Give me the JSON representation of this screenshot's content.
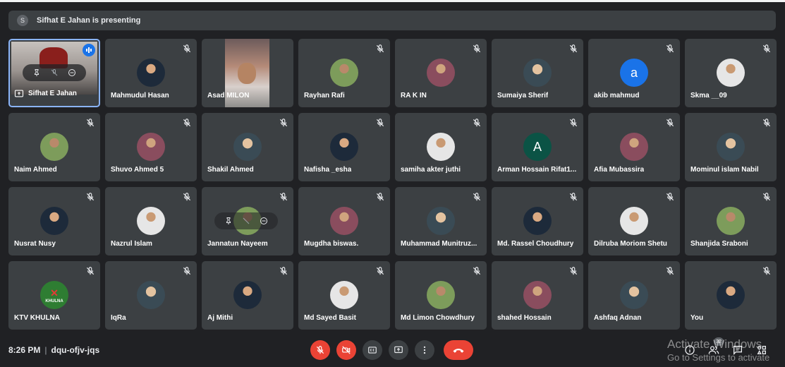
{
  "presenting_bar": {
    "avatar_letter": "S",
    "text": "Sifhat E Jahan is presenting"
  },
  "participants": [
    {
      "name": "Sifhat E Jahan",
      "kind": "presenter",
      "muted": false
    },
    {
      "name": "Mahmudul Hasan",
      "kind": "photo",
      "muted": true
    },
    {
      "name": "Asad MILON",
      "kind": "video",
      "muted": false
    },
    {
      "name": "Rayhan Rafi",
      "kind": "photo",
      "muted": true
    },
    {
      "name": "RA K IN",
      "kind": "photo",
      "muted": true
    },
    {
      "name": "Sumaiya Sherif",
      "kind": "photo",
      "muted": true
    },
    {
      "name": "akib mahmud",
      "kind": "letter",
      "letter": "a",
      "color": "#1a73e8",
      "muted": true
    },
    {
      "name": "Skma __09",
      "kind": "photo",
      "muted": true
    },
    {
      "name": "Naim Ahmed",
      "kind": "photo",
      "muted": true
    },
    {
      "name": "Shuvo Ahmed 5",
      "kind": "photo",
      "muted": true
    },
    {
      "name": "Shakil Ahmed",
      "kind": "photo",
      "muted": true
    },
    {
      "name": "Nafisha _esha",
      "kind": "photo",
      "muted": true
    },
    {
      "name": "samiha akter juthi",
      "kind": "photo",
      "muted": true
    },
    {
      "name": "Arman Hossain Rifat1...",
      "kind": "letter",
      "letter": "A",
      "color": "#0b5345",
      "muted": true
    },
    {
      "name": "Afia Mubassira",
      "kind": "photo",
      "muted": true
    },
    {
      "name": "Mominul islam Nabil",
      "kind": "photo",
      "muted": true
    },
    {
      "name": "Nusrat Nusy",
      "kind": "photo",
      "muted": true
    },
    {
      "name": "Nazrul Islam",
      "kind": "photo",
      "muted": true
    },
    {
      "name": "Jannatun Nayeem",
      "kind": "photo-hover",
      "muted": true
    },
    {
      "name": "Mugdha biswas.",
      "kind": "photo",
      "muted": true
    },
    {
      "name": "Muhammad Munitruz...",
      "kind": "photo",
      "muted": true
    },
    {
      "name": "Md. Rassel Choudhury",
      "kind": "photo",
      "muted": true
    },
    {
      "name": "Dilruba Moriom Shetu",
      "kind": "photo",
      "muted": true
    },
    {
      "name": "Shanjida Sraboni",
      "kind": "photo",
      "muted": true
    },
    {
      "name": "KTV KHULNA",
      "kind": "logo",
      "logo_text": "KHULNA",
      "muted": true
    },
    {
      "name": "IqRa",
      "kind": "photo",
      "muted": true
    },
    {
      "name": "Aj Mithi",
      "kind": "photo",
      "muted": true
    },
    {
      "name": "Md Sayed Basit",
      "kind": "photo",
      "muted": true
    },
    {
      "name": "Md Limon Chowdhury",
      "kind": "photo",
      "muted": true
    },
    {
      "name": "shahed Hossain",
      "kind": "photo",
      "muted": true
    },
    {
      "name": "Ashfaq Adnan",
      "kind": "photo",
      "muted": true
    },
    {
      "name": "You",
      "kind": "photo",
      "muted": true
    }
  ],
  "bottom_bar": {
    "time": "8:26 PM",
    "separator": "|",
    "meeting_code": "dqu-ofjv-jqs",
    "people_count": "32"
  },
  "watermark": {
    "line1": "Activate Windows",
    "line2": "Go to Settings to activate"
  },
  "colors": {
    "background": "#202124",
    "tile": "#3c4043",
    "accent_blue": "#8ab4f8",
    "red": "#ea4335"
  }
}
